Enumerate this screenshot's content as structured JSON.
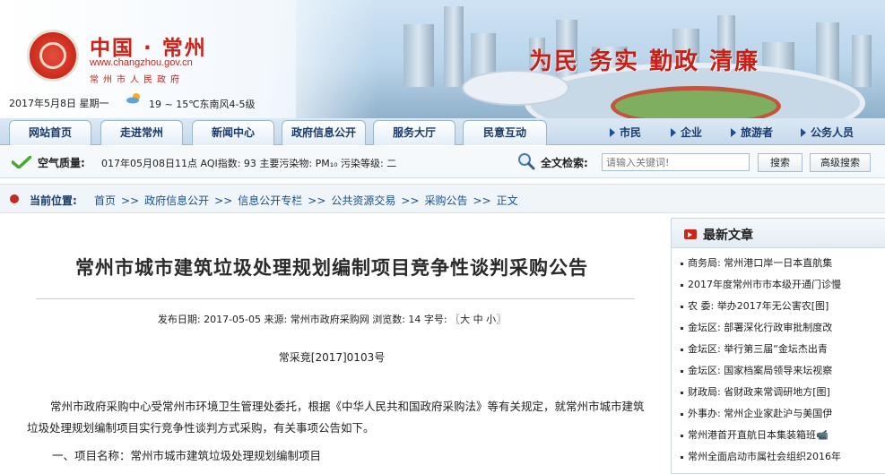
{
  "header": {
    "site_name": "中国 · 常州",
    "site_url": "www.changzhou.gov.cn",
    "site_gov": "常州市人民政府",
    "slogan": "为民  务实  勤政  清廉",
    "date": "2017年5月8日  星期一",
    "weather": "19 ~ 15℃东南风4-5级",
    "weather_icon": "cloud-sun-icon"
  },
  "nav": {
    "tabs": [
      {
        "label": "网站首页"
      },
      {
        "label": "走进常州"
      },
      {
        "label": "新闻中心"
      },
      {
        "label": "政府信息公开"
      },
      {
        "label": "服务大厅"
      },
      {
        "label": "民意互动"
      }
    ],
    "user_links": [
      {
        "label": "市民"
      },
      {
        "label": "企业"
      },
      {
        "label": "旅游者"
      },
      {
        "label": "公务人员"
      }
    ]
  },
  "air": {
    "label": "空气质量:",
    "text": "017年05月08日11点 AQI指数: 93 主要污染物: PM₁₀ 污染等级: 二"
  },
  "search": {
    "label": "全文检索:",
    "placeholder": "请输入关键词!",
    "button": "搜索",
    "advanced": "高级搜索"
  },
  "breadcrumb": {
    "label": "当前位置:",
    "items": [
      "首页",
      "政府信息公开",
      "信息公开专栏",
      "公共资源交易",
      "采购公告",
      "正文"
    ]
  },
  "article": {
    "title": "常州市城市建筑垃圾处理规划编制项目竞争性谈判采购公告",
    "meta": "发布日期: 2017-05-05  来源: 常州市政府采购网  浏览数: 14  字号: 〖大 中 小〗",
    "doc_number": "常采竞[2017]0103号",
    "paragraph": "常州市政府采购中心受常州市环境卫生管理处委托，根据《中华人民共和国政府采购法》等有关规定，就常州市城市建筑垃圾处理规划编制项目实行竞争性谈判方式采购，有关事项公告如下。",
    "item1": "一、项目名称：常州市城市建筑垃圾处理规划编制项目"
  },
  "sidebar": {
    "title": "最新文章",
    "items": [
      "商务局: 常州港口岸一日本直航集",
      "2017年度常州市市本级开通门诊慢",
      "农  委: 举办2017年无公害农[图]",
      "金坛区: 部署深化行政审批制度改",
      "金坛区: 举行第三届“金坛杰出青",
      "金坛区: 国家档案局领导来坛视察",
      "财政局: 省财政来常调研地方[图]",
      "外事办: 常州企业家赴沪与美国伊",
      "常州港首开直航日本集装箱班📹",
      "常州全面启动市属社会组织2016年"
    ]
  },
  "colors": {
    "brand_red": "#cc2318",
    "nav_blue": "#1a3a6a",
    "link_blue": "#1a4e8c"
  }
}
